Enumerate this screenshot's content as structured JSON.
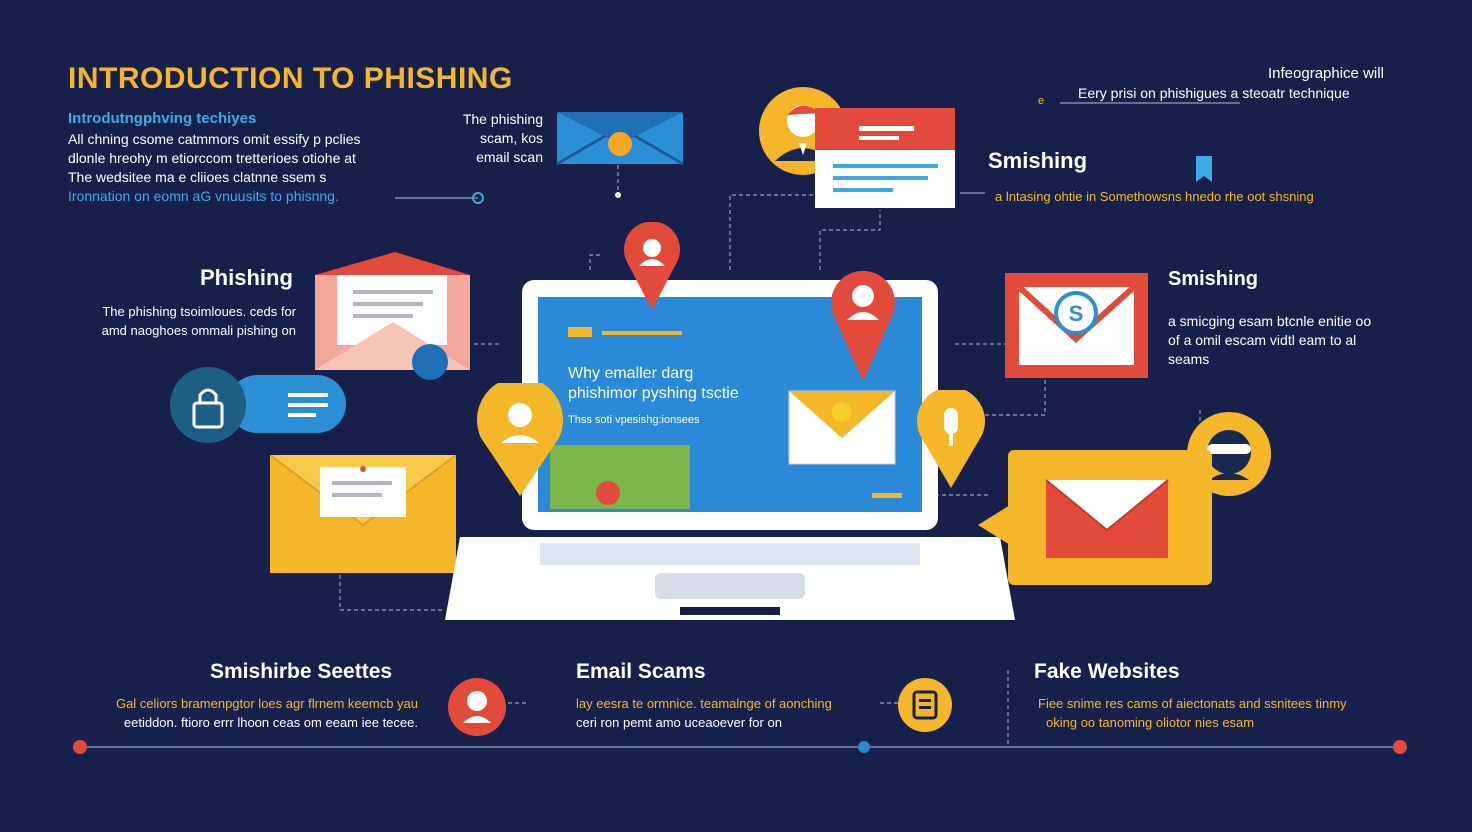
{
  "intro": {
    "title": "INTRODUCTION TO PHISHING",
    "subtitle": "Introdutngphving techiyes",
    "lines": [
      "All chning csome catmmors omit essify p pclies",
      "dlonle hreohy m etiorccom tretterioes otiohe at",
      "The wedsitee ma e cliioes clatnne ssem s"
    ],
    "line_blue": "Ironnation on eomn aG vnuusits to phisnng."
  },
  "email_note": {
    "lines": [
      "The phishing",
      "scam, kos",
      "email scan"
    ]
  },
  "top_right": {
    "line1": "Infeographice will",
    "line2": "Eery prisi on phishigues a steoatr technique",
    "mark": "e"
  },
  "smishing_top": {
    "heading": "Smishing",
    "text": "a lntasing ohtie in Somethowsns hnedo rhe oot shsning"
  },
  "phishing_left": {
    "heading": "Phishing",
    "lines": [
      "The phishing tsoimloues. ceds for",
      "amd naoghoes ommali pishing on"
    ]
  },
  "smishing_right": {
    "heading": "Smishing",
    "lines": [
      "a smicging esam btcnle enitie oo",
      "of a omil escam vidtl eam to al",
      "seams"
    ]
  },
  "screen": {
    "lines": [
      "Why emaller darg",
      "phishimor pyshing tsctie"
    ],
    "small": "Thss soti vpesishg:ionsees"
  },
  "bottom": {
    "col1": {
      "heading": "Smishirbe Seettes",
      "lines": [
        "Gal celiors bramenpgtor loes agr flrnem keemcb yau",
        "eetiddon. ftioro errr lhoon ceas om eeam iee tecee."
      ]
    },
    "col2": {
      "heading": "Email Scams",
      "lines": [
        "lay eesra te ormnice. teamalnge of aonching",
        "ceri ron pemt amo uceaoever for on"
      ]
    },
    "col3": {
      "heading": "Fake Websites",
      "lines": [
        "Fiee snime res cams of aiectonats and ssnitees tinmy",
        "oking oo tanoming oliotor nies esam"
      ]
    }
  },
  "colors": {
    "background": "#16204a",
    "accent_yellow": "#f5b72a",
    "accent_blue": "#3fa8e6",
    "accent_red": "#e24b3b"
  }
}
